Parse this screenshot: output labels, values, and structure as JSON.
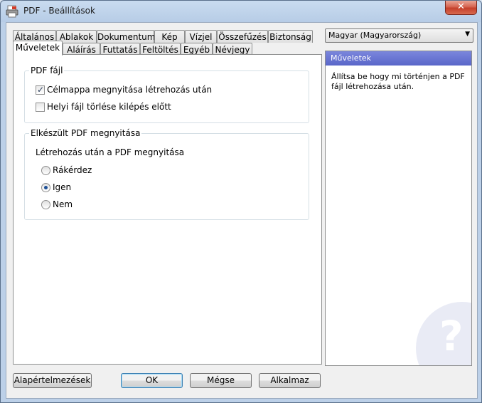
{
  "window": {
    "title": "PDF - Beállítások",
    "close_label": "✕"
  },
  "tabs_row1": [
    "Általános",
    "Ablakok",
    "Dokumentum",
    "Kép",
    "Vízjel",
    "Összefűzés",
    "Biztonság"
  ],
  "tabs_row2": [
    "Műveletek",
    "Aláírás",
    "Futtatás",
    "Feltöltés",
    "Egyéb",
    "Névjegy"
  ],
  "active_tab": "Műveletek",
  "group_pdf": {
    "title": "PDF fájl",
    "option1": {
      "label": "Célmappa megnyitása létrehozás után",
      "checked": true
    },
    "option2": {
      "label": "Helyi fájl törlése kilépés előtt",
      "checked": false
    }
  },
  "group_open": {
    "title": "Elkészült PDF megnyitása",
    "prompt": "Létrehozás után a PDF megnyitása",
    "radio1": "Rákérdez",
    "radio2": "Igen",
    "radio3": "Nem",
    "selected": "Igen"
  },
  "language": {
    "value": "Magyar (Magyarország)"
  },
  "help": {
    "title": "Műveletek",
    "text": "Állítsa be hogy mi történjen a PDF fájl létrehozása után.",
    "icon_glyph": "?"
  },
  "buttons": {
    "defaults": "Alapértelmezések",
    "ok": "OK",
    "cancel": "Mégse",
    "apply": "Alkalmaz"
  }
}
